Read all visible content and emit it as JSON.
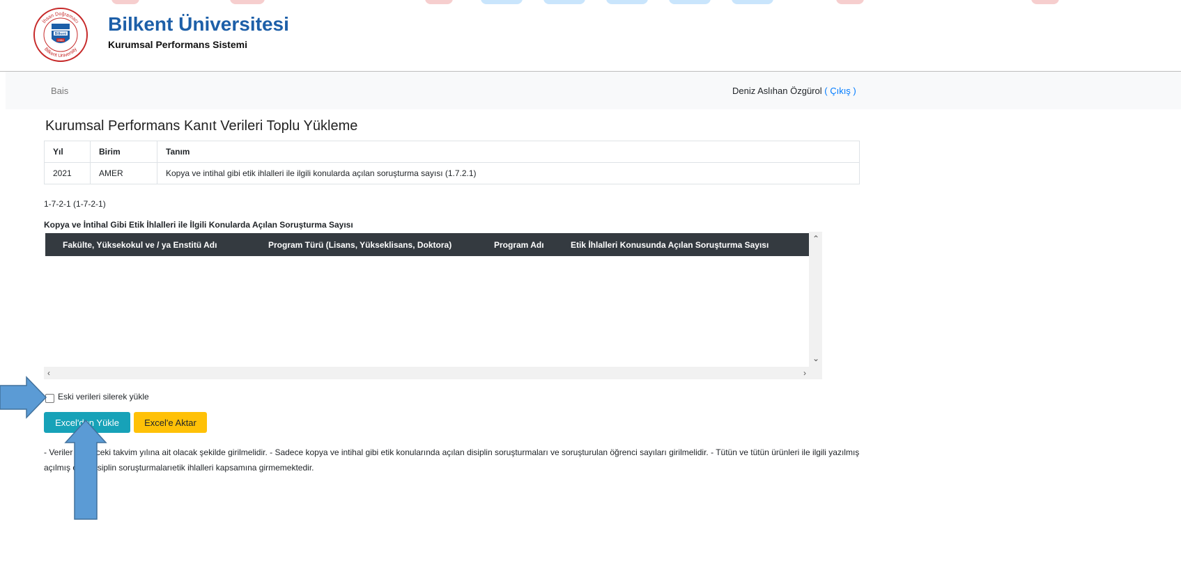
{
  "header": {
    "title": "Bilkent Üniversitesi",
    "subtitle": "Kurumsal Performans Sistemi",
    "logo_text": [
      "İhsan Doğramacı",
      "Bilkent University",
      "Bilkent",
      "1984"
    ]
  },
  "navbar": {
    "brand_link": "Bais",
    "user_name": "Deniz Aslıhan Özgürol",
    "logout_open": " ( ",
    "logout_label": "Çıkış",
    "logout_close": " )"
  },
  "page_title": "Kurumsal Performans Kanıt Verileri Toplu Yükleme",
  "info_table": {
    "headers": [
      "Yıl",
      "Birim",
      "Tanım"
    ],
    "row": [
      "2021",
      "AMER",
      "Kopya ve intihal gibi etik ihlalleri ile ilgili konularda açılan soruşturma sayısı (1.7.2.1)"
    ]
  },
  "code_label": "1-7-2-1 (1-7-2-1)",
  "grid": {
    "title": "Kopya ve İntihal Gibi Etik İhlalleri ile İlgili Konularda Açılan Soruşturma Sayısı",
    "columns": [
      "Fakülte, Yüksekokul ve / ya Enstitü Adı",
      "Program Türü (Lisans, Yükseklisans, Doktora)",
      "Program Adı",
      "Etik İhlalleri Konusunda Açılan Soruşturma Sayısı"
    ],
    "rows": []
  },
  "checkbox": {
    "label": "Eski verileri silerek yükle",
    "checked": false
  },
  "buttons": {
    "import": "Excel'den Yükle",
    "export": "Excel'e Aktar"
  },
  "notes": "- Veriler bir önceki takvim yılına ait olacak şekilde girilmelidir. - Sadece kopya ve intihal gibi etik konularında açılan disiplin soruşturmaları ve soruşturulan öğrenci sayıları girilmelidir. - Tütün ve tütün ürünleri ile ilgili yazılmış açılmış olan disiplin soruşturmalarıetik ihlalleri kapsamına girmemektedir.",
  "colors": {
    "brand": "#1d5fa8",
    "grid_header": "#343a40",
    "btn_info": "#17a2b8",
    "btn_warning": "#ffc107",
    "annotation_arrow": "#5b9bd5"
  }
}
